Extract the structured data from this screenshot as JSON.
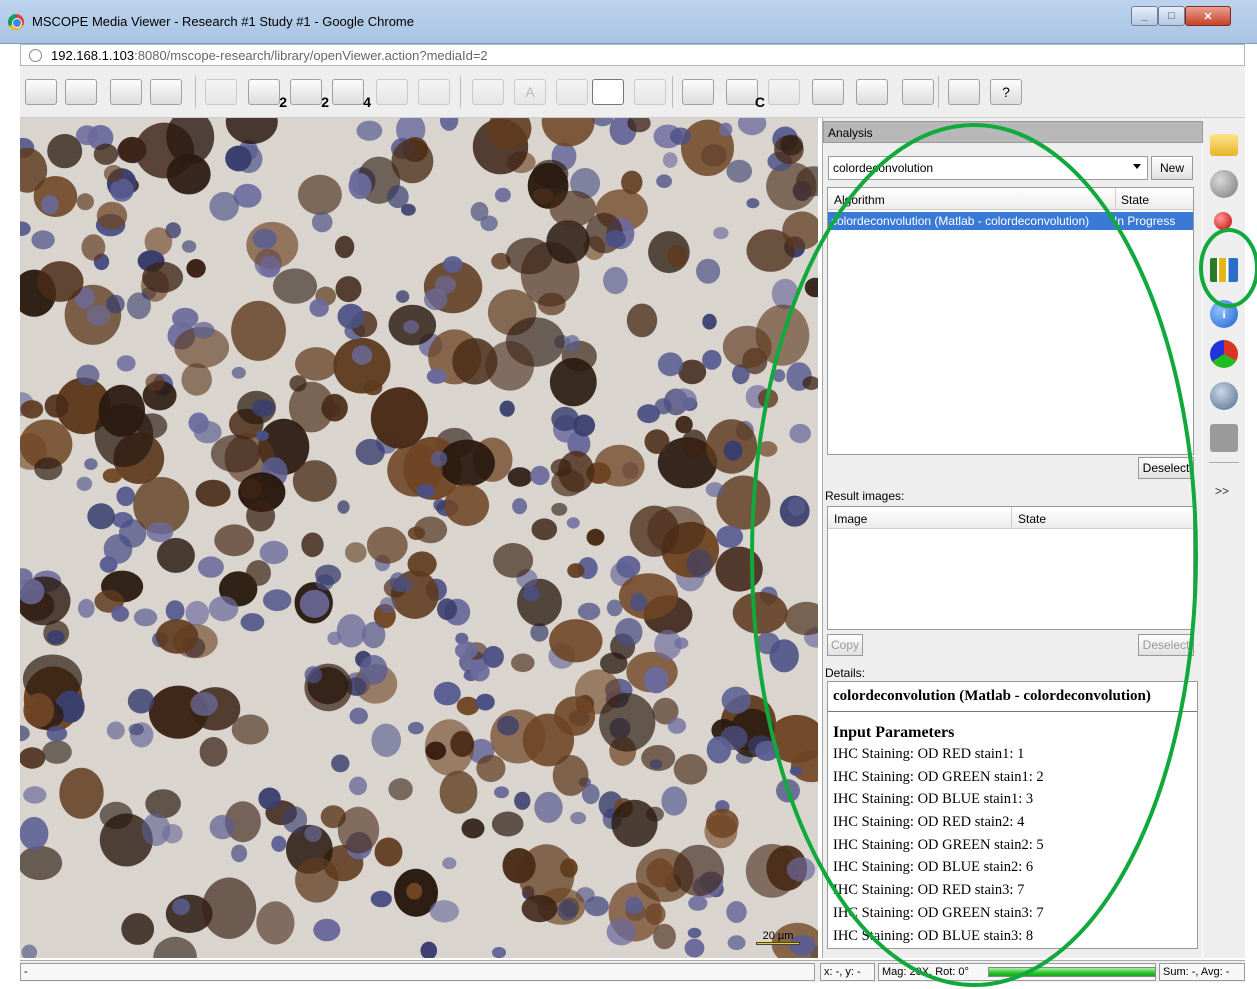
{
  "window": {
    "title": "MSCOPE Media Viewer - Research #1 Study #1 - Google Chrome",
    "url_host": "192.168.1.103",
    "url_rest": ":8080/mscope-research/library/openViewer.action?mediaId=2"
  },
  "toolbar": {
    "buttons": [
      {
        "name": "fit-window-icon",
        "badge": ""
      },
      {
        "name": "fit-height-icon",
        "badge": ""
      },
      {
        "name": "fit-width-icon",
        "badge": ""
      },
      {
        "name": "magnifier-icon",
        "badge": ""
      },
      {
        "name": "layout-1-icon",
        "badge": ""
      },
      {
        "name": "layout-2v-icon",
        "badge": "2"
      },
      {
        "name": "layout-2h-icon",
        "badge": "2"
      },
      {
        "name": "layout-4-icon",
        "badge": "4"
      },
      {
        "name": "sync-view-icon",
        "badge": ""
      },
      {
        "name": "overlay-icon",
        "badge": ""
      },
      {
        "name": "vertical-ruler-icon",
        "badge": ""
      },
      {
        "name": "text-annotation-icon",
        "badge": "A"
      },
      {
        "name": "horizontal-ruler-icon",
        "badge": ""
      },
      {
        "name": "scale-marker-icon",
        "badge": ""
      },
      {
        "name": "scalebar-toggle-icon",
        "badge": ""
      },
      {
        "name": "snapshot-icon",
        "badge": ""
      },
      {
        "name": "snapshot-copy-icon",
        "badge": "C"
      },
      {
        "name": "snapshot-folder-icon",
        "badge": ""
      },
      {
        "name": "print-icon",
        "badge": ""
      },
      {
        "name": "save-region-icon",
        "badge": ""
      },
      {
        "name": "select-region-icon",
        "badge": ""
      },
      {
        "name": "window-mode-icon",
        "badge": ""
      },
      {
        "name": "help-icon",
        "badge": "?"
      }
    ]
  },
  "viewer": {
    "scale_label": "20 µm"
  },
  "analysis": {
    "header": "Analysis",
    "selected_algorithm": "colordeconvolution",
    "new_label": "New",
    "columns": {
      "algorithm": "Algorithm",
      "state": "State"
    },
    "rows": [
      {
        "algorithm": "colordeconvolution (Matlab - colordeconvolution)",
        "state": "In Progress"
      }
    ],
    "deselect_label": "Deselect",
    "result_images_label": "Result images:",
    "result_columns": {
      "image": "Image",
      "state": "State"
    },
    "copy_label": "Copy",
    "result_deselect_label": "Deselect",
    "details_label": "Details:",
    "details": {
      "title": "colordeconvolution (Matlab - colordeconvolution)",
      "section": "Input Parameters",
      "params": [
        "IHC Staining: OD RED stain1: 1",
        "IHC Staining: OD GREEN stain1: 2",
        "IHC Staining: OD BLUE stain1: 3",
        "IHC Staining: OD RED stain2: 4",
        "IHC Staining: OD GREEN stain2: 5",
        "IHC Staining: OD BLUE stain2: 6",
        "IHC Staining: OD RED stain3: 7",
        "IHC Staining: OD GREEN stain3: 7",
        "IHC Staining: OD BLUE stain3: 8"
      ]
    }
  },
  "sidebar": {
    "icons": [
      "folder-icon",
      "grey-sphere-icon",
      "red-pin-icon",
      "chart-icon",
      "info-icon",
      "color-channels-icon",
      "user-comment-icon",
      "tag-icon"
    ],
    "more_label": ">>"
  },
  "statusbar": {
    "left": "-",
    "coords": "x: -, y: -",
    "mag": "Mag: 20X, Rot: 0°",
    "progress": 1.0,
    "stats": "Sum: -, Avg: -"
  },
  "colors": {
    "annotation": "#11a83c",
    "selection": "#3a7ad6",
    "progress": "#28c628"
  }
}
